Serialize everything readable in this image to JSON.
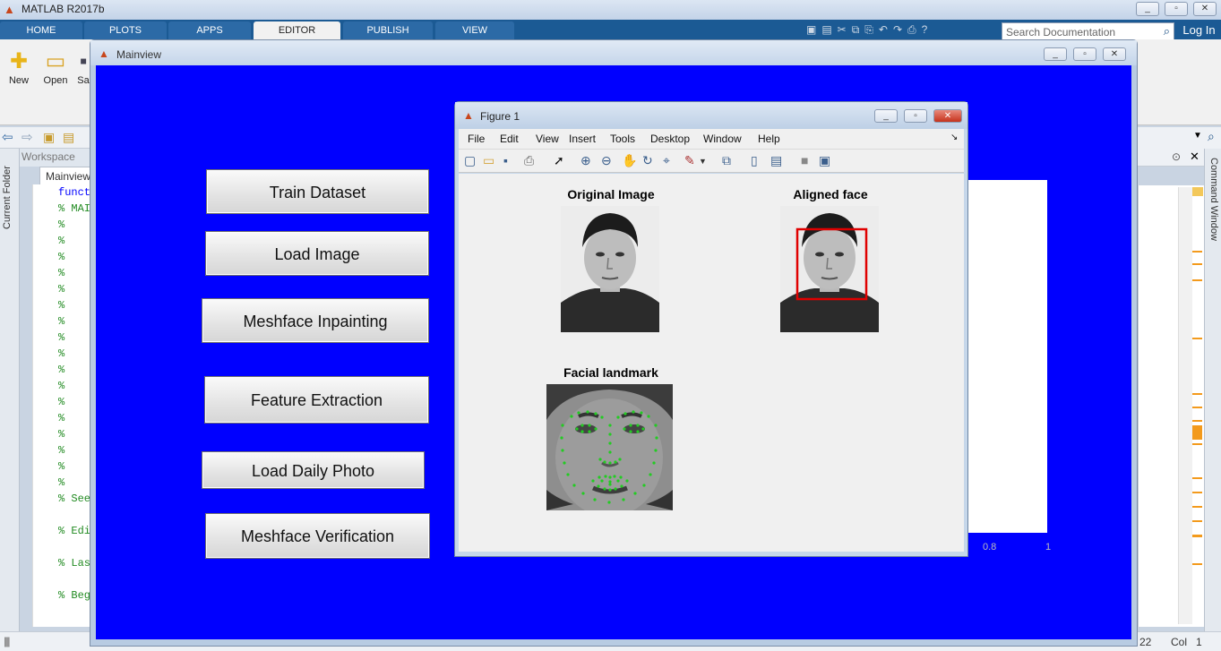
{
  "matlab": {
    "title": "MATLAB R2017b",
    "tabs": [
      "HOME",
      "PLOTS",
      "APPS",
      "EDITOR",
      "PUBLISH",
      "VIEW"
    ],
    "active_tab": "EDITOR",
    "search_placeholder": "Search Documentation",
    "login": "Log In",
    "ribbon": {
      "new": "New",
      "open": "Open",
      "save": "Sa"
    },
    "workspace": "Workspace",
    "current_folder": "Current Folder",
    "editor_tab": "Mainview",
    "editor_lines": [
      "funct",
      "% MAI",
      "%",
      "%",
      "%",
      "%",
      "%",
      "%",
      "%",
      "%",
      "%",
      "%",
      "%",
      "%",
      "%",
      "%",
      "%",
      "%",
      "%",
      "% See",
      "",
      "% Edi",
      "",
      "% Las",
      "",
      "% Beg"
    ],
    "command_window": "Command Window",
    "status": {
      "ln": "22",
      "col_label": "Col",
      "col": "1"
    }
  },
  "mainview": {
    "title": "Mainview",
    "buttons": {
      "train": "Train Dataset",
      "load": "Load Image",
      "inpaint": "Meshface Inpainting",
      "feature": "Feature Extraction",
      "daily": "Load Daily Photo",
      "verify": "Meshface Verification"
    },
    "axis_ticks": [
      "0.8",
      "1"
    ]
  },
  "figure": {
    "title": "Figure 1",
    "menu": [
      "File",
      "Edit",
      "View",
      "Insert",
      "Tools",
      "Desktop",
      "Window",
      "Help"
    ],
    "plots": {
      "original": "Original Image",
      "aligned": "Aligned face",
      "landmark": "Facial landmark"
    }
  },
  "colors": {
    "background": "#0000ff",
    "ribbon_tab": "#1b5a94",
    "box": "#e00000",
    "landmark": "#22cc22"
  }
}
